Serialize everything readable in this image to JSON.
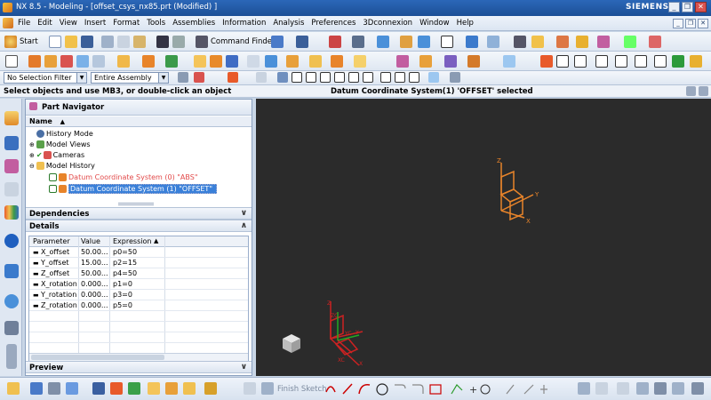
{
  "window": {
    "title": "NX 8.5 - Modeling - [offset_csys_nx85.prt (Modified) ]",
    "brand": "SIEMENS",
    "minimize_glyph": "_",
    "restore_glyph": "❐",
    "close_glyph": "✕"
  },
  "menu": {
    "items": [
      "File",
      "Edit",
      "View",
      "Insert",
      "Format",
      "Tools",
      "Assemblies",
      "Information",
      "Analysis",
      "Preferences",
      "3Dconnexion",
      "Window",
      "Help"
    ]
  },
  "toolbar1": {
    "start_label": "Start",
    "command_finder_label": "Command Finder"
  },
  "toolbar2": {
    "selection_filter": "No Selection Filter",
    "assembly_scope": "Entire Assembly"
  },
  "status": {
    "prompt": "Select objects and use MB3, or double-click an object",
    "message": "Datum Coordinate System(1) 'OFFSET' selected"
  },
  "navigator": {
    "title": "Part Navigator",
    "column_name": "Name",
    "sort_glyph": "▲",
    "tree": [
      {
        "label": "History Mode"
      },
      {
        "label": "Model Views"
      },
      {
        "label": "Cameras"
      },
      {
        "label": "Model History"
      },
      {
        "label": "Datum Coordinate System (0) \"ABS\""
      },
      {
        "label": "Datum Coordinate System (1) \"OFFSET\""
      }
    ],
    "dependencies_label": "Dependencies",
    "details_label": "Details",
    "preview_label": "Preview",
    "details": {
      "headers": [
        "Parameter",
        "Value",
        "Expression"
      ],
      "rows": [
        {
          "param": "X_offset",
          "value": "50.00...",
          "expr": "p0=50"
        },
        {
          "param": "Y_offset",
          "value": "15.00...",
          "expr": "p2=15"
        },
        {
          "param": "Z_offset",
          "value": "50.00...",
          "expr": "p4=50"
        },
        {
          "param": "X_rotation",
          "value": "0.000...",
          "expr": "p1=0"
        },
        {
          "param": "Y_rotation",
          "value": "0.000...",
          "expr": "p3=0"
        },
        {
          "param": "Z_rotation",
          "value": "0.000...",
          "expr": "p5=0"
        }
      ]
    }
  },
  "graphics": {
    "offset_csys_axes": [
      "Z",
      "Y",
      "X"
    ],
    "abs_csys_axes": [
      "ZC",
      "YC",
      "XC"
    ],
    "abs_axis_short": [
      "Z",
      "Y",
      "X"
    ],
    "colors": {
      "background": "#2b2b2b",
      "offset_csys": "#e8842a",
      "abs_csys": "#cc2222"
    }
  },
  "bottom_toolbar": {
    "finish_sketch_label": "Finish Sketch"
  }
}
